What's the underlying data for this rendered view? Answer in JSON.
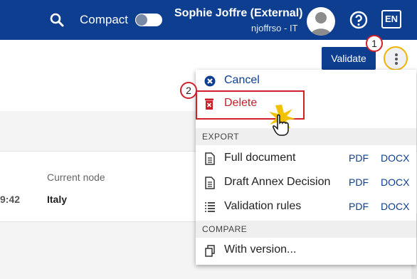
{
  "header": {
    "compact_label": "Compact",
    "user_name": "Sophie Joffre (External)",
    "user_sub": "njoffrso - IT",
    "lang": "EN"
  },
  "toolbar": {
    "validate_label": "Validate"
  },
  "content": {
    "time_partial": "9:42",
    "current_node_label": "Current node",
    "current_node_value": "Italy"
  },
  "menu": {
    "cancel_label": "Cancel",
    "delete_label": "Delete",
    "export_header": "EXPORT",
    "compare_header": "COMPARE",
    "exports": [
      {
        "label": "Full document",
        "pdf": "PDF",
        "docx": "DOCX"
      },
      {
        "label": "Draft Annex Decision",
        "pdf": "PDF",
        "docx": "DOCX"
      },
      {
        "label": "Validation rules",
        "pdf": "PDF",
        "docx": "DOCX"
      }
    ],
    "with_version_label": "With version..."
  },
  "annotations": {
    "step1": "1",
    "step2": "2"
  },
  "colors": {
    "brand": "#0d3e8f",
    "delete": "#c8202a",
    "callout_border": "#d0202a",
    "kebab_ring": "#f0b400"
  }
}
